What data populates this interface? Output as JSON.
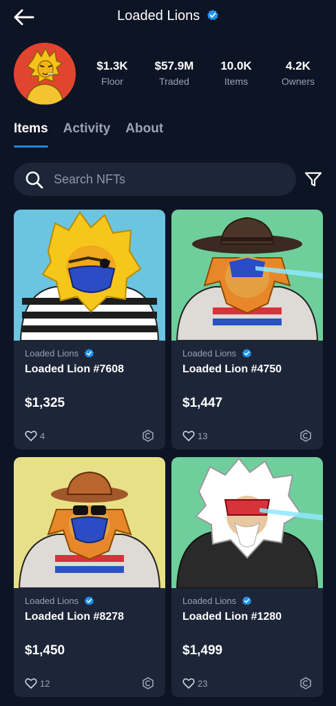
{
  "header": {
    "title": "Loaded Lions"
  },
  "stats": [
    {
      "value": "$1.3K",
      "label": "Floor"
    },
    {
      "value": "$57.9M",
      "label": "Traded"
    },
    {
      "value": "10.0K",
      "label": "Items"
    },
    {
      "value": "4.2K",
      "label": "Owners"
    }
  ],
  "tabs": [
    {
      "label": "Items",
      "active": true
    },
    {
      "label": "Activity",
      "active": false
    },
    {
      "label": "About",
      "active": false
    }
  ],
  "search": {
    "placeholder": "Search NFTs"
  },
  "cards": [
    {
      "collection": "Loaded Lions",
      "name": "Loaded Lion #7608",
      "price": "$1,325",
      "likes": "4",
      "bg": "#6bc4e0"
    },
    {
      "collection": "Loaded Lions",
      "name": "Loaded Lion #4750",
      "price": "$1,447",
      "likes": "13",
      "bg": "#6fcf9c"
    },
    {
      "collection": "Loaded Lions",
      "name": "Loaded Lion #8278",
      "price": "$1,450",
      "likes": "12",
      "bg": "#e8e086"
    },
    {
      "collection": "Loaded Lions",
      "name": "Loaded Lion #1280",
      "price": "$1,499",
      "likes": "23",
      "bg": "#6fcf9c"
    }
  ],
  "icons": {
    "back": "arrow-left-icon",
    "verified": "verified-badge-icon",
    "search": "search-icon",
    "filter": "filter-icon",
    "like": "heart-icon",
    "chain": "chain-logo-icon"
  },
  "colors": {
    "background": "#0d1424",
    "surface": "#1c2638",
    "accent": "#1e88e5",
    "muted": "#9aa3b5"
  }
}
